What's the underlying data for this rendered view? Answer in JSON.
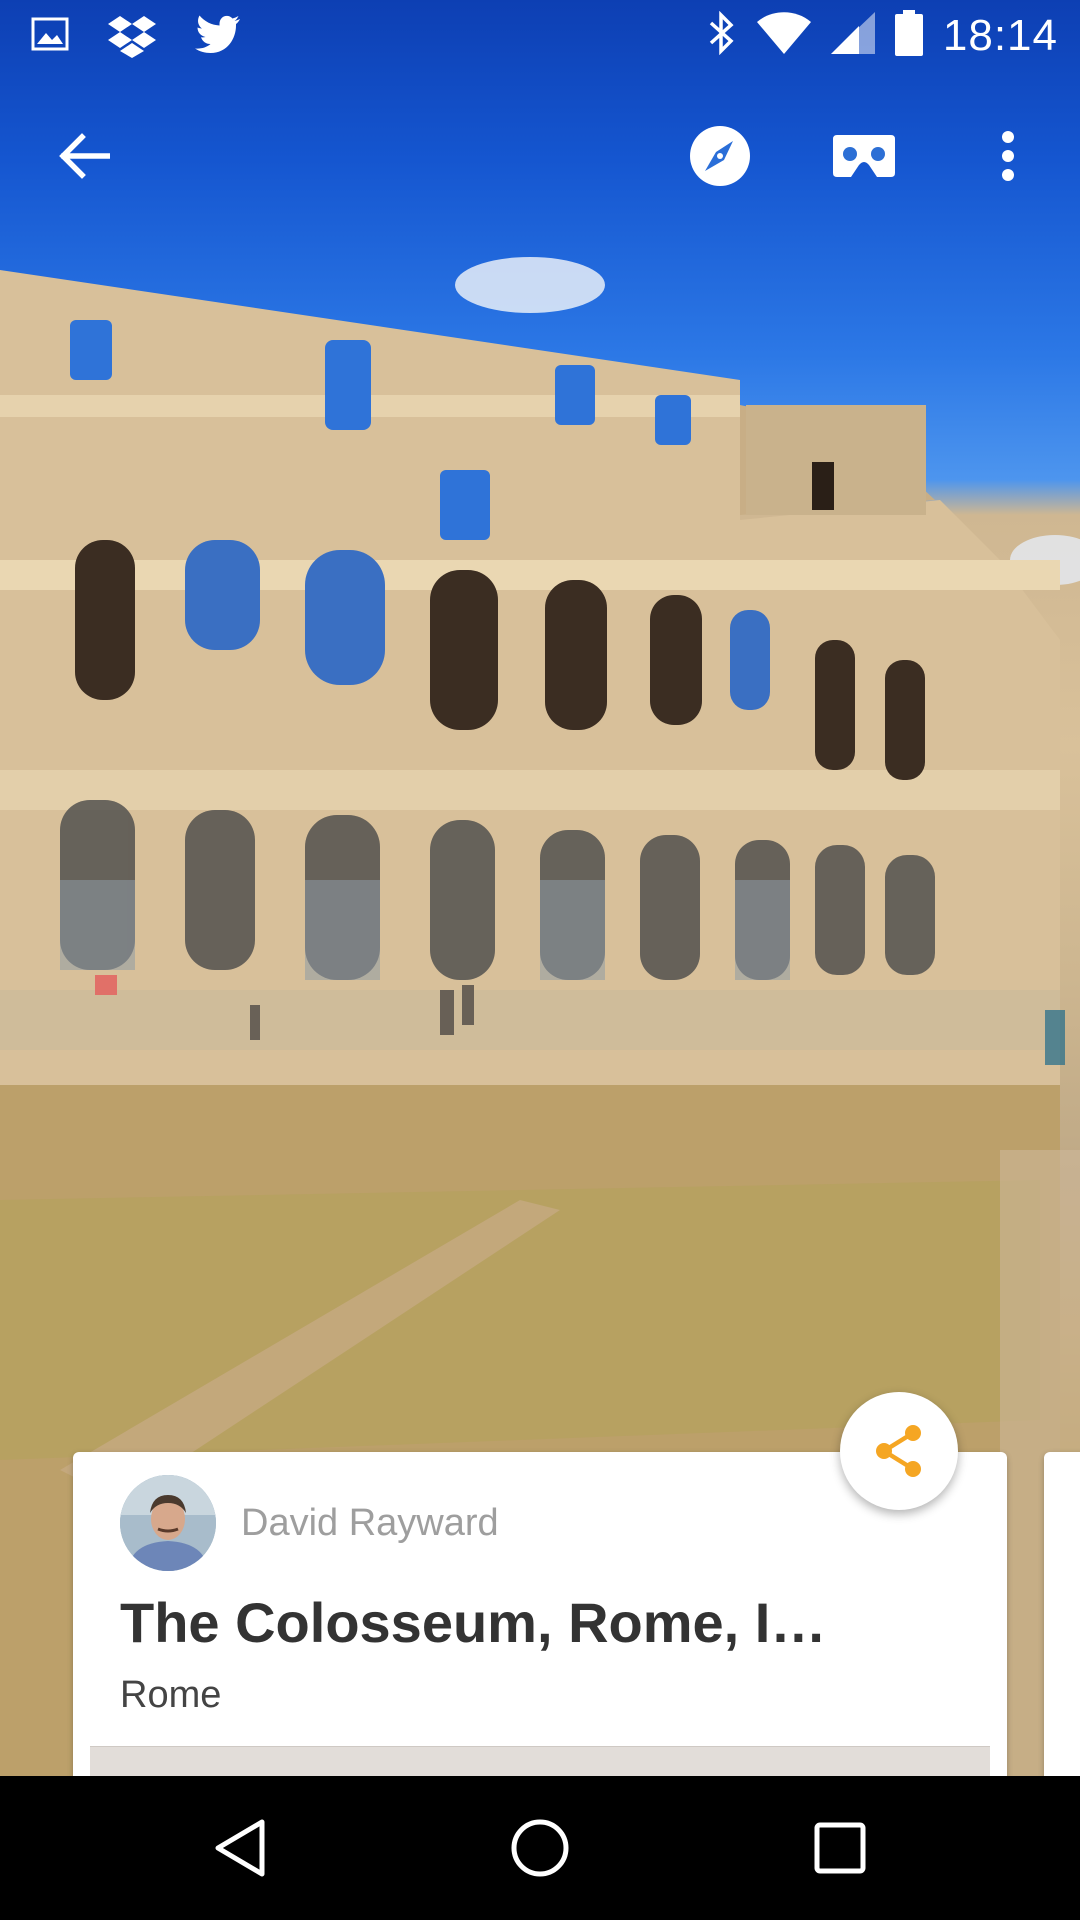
{
  "status_bar": {
    "time": "18:14",
    "left_icons": [
      "gallery-icon",
      "dropbox-icon",
      "twitter-icon"
    ],
    "right_icons": [
      "bluetooth-icon",
      "wifi-icon",
      "cell-signal-icon",
      "battery-icon"
    ]
  },
  "toolbar": {
    "back_icon": "arrow-back-icon",
    "actions": [
      "compass-icon",
      "cardboard-vr-icon",
      "more-vert-icon"
    ]
  },
  "share": {
    "icon": "share-icon",
    "color": "#f5a623"
  },
  "card": {
    "author": "David Rayward",
    "title": "The Colosseum, Rome, I…",
    "location": "Rome"
  },
  "nav_bar": {
    "buttons": [
      "back-triangle-icon",
      "home-circle-icon",
      "recents-square-icon"
    ]
  }
}
